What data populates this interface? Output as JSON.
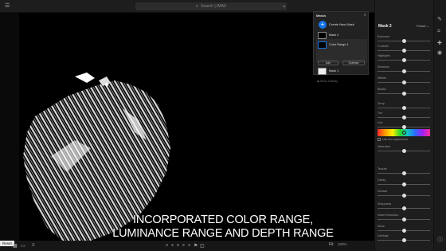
{
  "topbar": {
    "search_placeholder": "Search | IMAX"
  },
  "caption": {
    "line1": "INCORPORATED COLOR RANGE,",
    "line2": "LUMINANCE RANGE AND DEPTH RANGE"
  },
  "bottombar": {
    "reset_tip": "Reset",
    "fit_label": "Fit",
    "zoom_label": "100%"
  },
  "masks_panel": {
    "title": "Masks",
    "create_label": "Create New Mask",
    "mask2_name": "Mask 2",
    "color_range_name": "Color Range 1",
    "add_label": "Add",
    "subtract_label": "Subtract",
    "mask1_name": "Mask 1",
    "show_overlay_label": "Show Overlay"
  },
  "right_panel": {
    "mask_title": "Mask 2",
    "preset_label": "Preset",
    "use_fine_label": "Use fine adjustment",
    "sliders": [
      {
        "label": "Exposure",
        "value": 0.5
      },
      {
        "label": "Contrast",
        "value": 0.5
      },
      {
        "label": "Highlights",
        "value": 0.5
      },
      {
        "label": "Shadows",
        "value": 0.5
      },
      {
        "label": "Whites",
        "value": 0.5
      },
      {
        "label": "Blacks",
        "value": 0.5
      },
      {
        "label": "Temp",
        "value": 0.5
      },
      {
        "label": "Tint",
        "value": 0.5
      },
      {
        "label": "Hue",
        "value": 0.5
      },
      {
        "label": "Saturation",
        "value": 0.5
      },
      {
        "label": "Texture",
        "value": 0.5
      },
      {
        "label": "Clarity",
        "value": 0.5
      },
      {
        "label": "Dehaze",
        "value": 0.5
      },
      {
        "label": "Sharpness",
        "value": 0.5
      },
      {
        "label": "Noise Reduction",
        "value": 0.5
      },
      {
        "label": "Moire",
        "value": 0.5
      },
      {
        "label": "Defringe",
        "value": 0.5
      }
    ],
    "colors": {
      "accent": "#1473e6",
      "panel_bg": "#1e1e1e"
    }
  }
}
